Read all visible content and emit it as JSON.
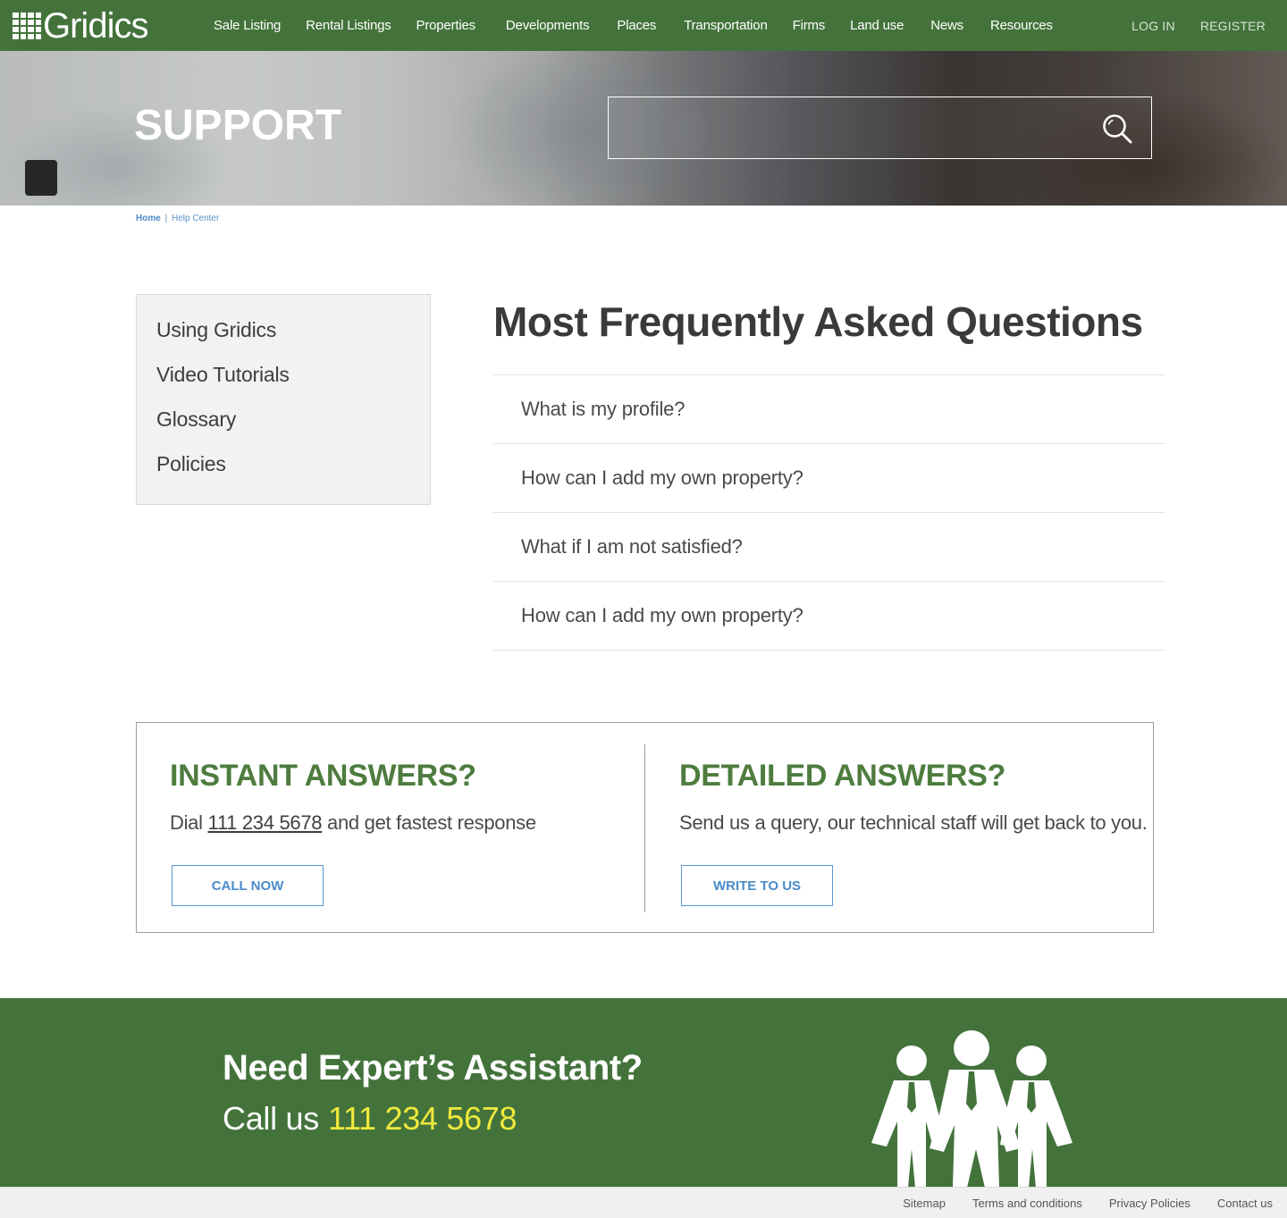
{
  "brand": {
    "name": "Gridics"
  },
  "nav": {
    "links": [
      "Sale Listing",
      "Rental Listings",
      "Properties",
      "Developments",
      "Places",
      "Transportation",
      "Firms",
      "Land use",
      "News",
      "Resources"
    ],
    "login": "LOG IN",
    "register": "REGISTER"
  },
  "hero": {
    "title": "SUPPORT",
    "search_placeholder": "",
    "search_icon": "search-icon"
  },
  "breadcrumb": {
    "home": "Home",
    "separator": "|",
    "current": "Help Center"
  },
  "sidebar": {
    "items": [
      "Using Gridics",
      "Video Tutorials",
      "Glossary",
      "Policies"
    ]
  },
  "faq": {
    "title": "Most Frequently Asked Questions",
    "items": [
      "What is my profile?",
      "How can I add my own property?",
      "What if I am not satisfied?",
      "How can I add my own property?"
    ]
  },
  "instant": {
    "title": "INSTANT ANSWERS?",
    "text_before": "Dial ",
    "phone": "111 234 5678",
    "text_after": " and get fastest response",
    "button": "CALL NOW"
  },
  "detailed": {
    "title": "DETAILED ANSWERS?",
    "text": "Send us a query, our technical staff will get back to you.",
    "button": "WRITE TO US"
  },
  "expert": {
    "title": "Need Expert’s Assistant?",
    "call_label": "Call us",
    "phone": "111 234 5678",
    "icon": "team-people-icon"
  },
  "footer": {
    "links": [
      "Sitemap",
      "Terms and conditions",
      "Privacy Policies",
      "Contact us"
    ]
  },
  "colors": {
    "brand_green": "#43733b",
    "heading_green": "#4e7c3f",
    "link_blue": "#4a8bc9",
    "phone_yellow": "#f0e83c"
  }
}
